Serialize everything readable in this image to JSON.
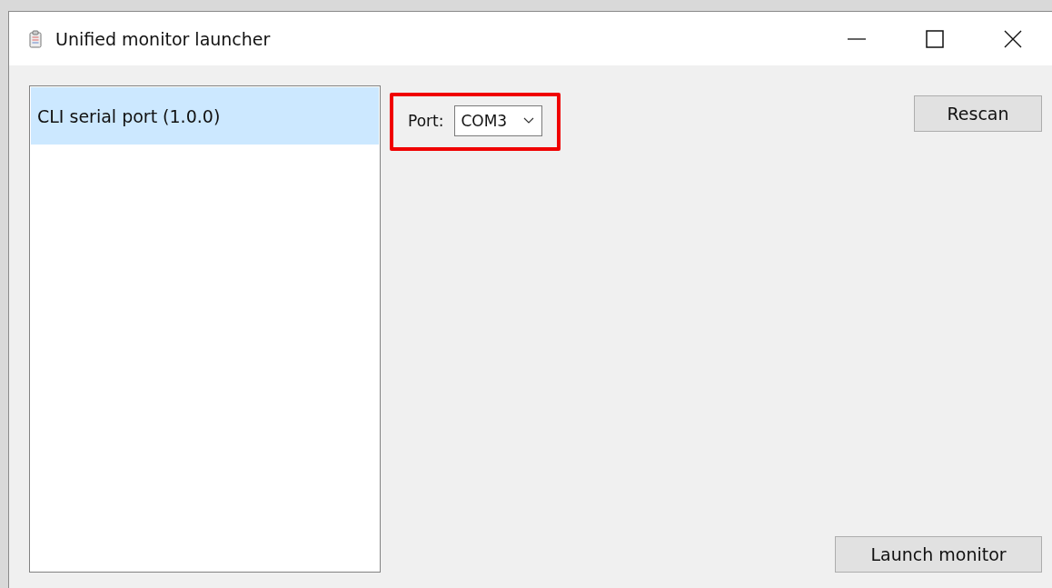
{
  "window": {
    "title": "Unified monitor launcher"
  },
  "monitors": [
    {
      "label": "CLI serial port (1.0.0)",
      "selected": true
    }
  ],
  "port": {
    "label": "Port:",
    "value": "COM3",
    "highlighted": true
  },
  "buttons": {
    "rescan": "Rescan",
    "launch": "Launch monitor"
  }
}
